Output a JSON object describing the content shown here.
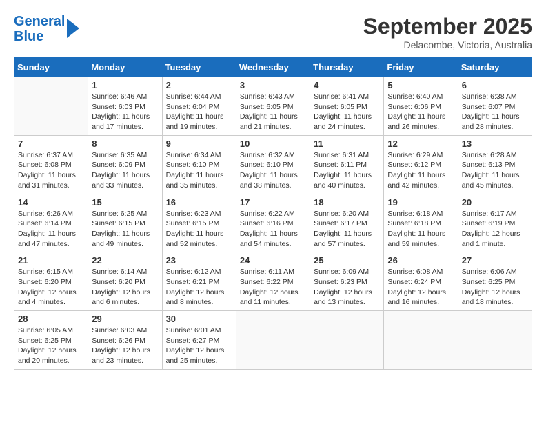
{
  "header": {
    "logo_line1": "General",
    "logo_line2": "Blue",
    "title": "September 2025",
    "subtitle": "Delacombe, Victoria, Australia"
  },
  "calendar": {
    "days_of_week": [
      "Sunday",
      "Monday",
      "Tuesday",
      "Wednesday",
      "Thursday",
      "Friday",
      "Saturday"
    ],
    "weeks": [
      [
        {
          "day": "",
          "info": ""
        },
        {
          "day": "1",
          "info": "Sunrise: 6:46 AM\nSunset: 6:03 PM\nDaylight: 11 hours and 17 minutes."
        },
        {
          "day": "2",
          "info": "Sunrise: 6:44 AM\nSunset: 6:04 PM\nDaylight: 11 hours and 19 minutes."
        },
        {
          "day": "3",
          "info": "Sunrise: 6:43 AM\nSunset: 6:05 PM\nDaylight: 11 hours and 21 minutes."
        },
        {
          "day": "4",
          "info": "Sunrise: 6:41 AM\nSunset: 6:05 PM\nDaylight: 11 hours and 24 minutes."
        },
        {
          "day": "5",
          "info": "Sunrise: 6:40 AM\nSunset: 6:06 PM\nDaylight: 11 hours and 26 minutes."
        },
        {
          "day": "6",
          "info": "Sunrise: 6:38 AM\nSunset: 6:07 PM\nDaylight: 11 hours and 28 minutes."
        }
      ],
      [
        {
          "day": "7",
          "info": "Sunrise: 6:37 AM\nSunset: 6:08 PM\nDaylight: 11 hours and 31 minutes."
        },
        {
          "day": "8",
          "info": "Sunrise: 6:35 AM\nSunset: 6:09 PM\nDaylight: 11 hours and 33 minutes."
        },
        {
          "day": "9",
          "info": "Sunrise: 6:34 AM\nSunset: 6:10 PM\nDaylight: 11 hours and 35 minutes."
        },
        {
          "day": "10",
          "info": "Sunrise: 6:32 AM\nSunset: 6:10 PM\nDaylight: 11 hours and 38 minutes."
        },
        {
          "day": "11",
          "info": "Sunrise: 6:31 AM\nSunset: 6:11 PM\nDaylight: 11 hours and 40 minutes."
        },
        {
          "day": "12",
          "info": "Sunrise: 6:29 AM\nSunset: 6:12 PM\nDaylight: 11 hours and 42 minutes."
        },
        {
          "day": "13",
          "info": "Sunrise: 6:28 AM\nSunset: 6:13 PM\nDaylight: 11 hours and 45 minutes."
        }
      ],
      [
        {
          "day": "14",
          "info": "Sunrise: 6:26 AM\nSunset: 6:14 PM\nDaylight: 11 hours and 47 minutes."
        },
        {
          "day": "15",
          "info": "Sunrise: 6:25 AM\nSunset: 6:15 PM\nDaylight: 11 hours and 49 minutes."
        },
        {
          "day": "16",
          "info": "Sunrise: 6:23 AM\nSunset: 6:15 PM\nDaylight: 11 hours and 52 minutes."
        },
        {
          "day": "17",
          "info": "Sunrise: 6:22 AM\nSunset: 6:16 PM\nDaylight: 11 hours and 54 minutes."
        },
        {
          "day": "18",
          "info": "Sunrise: 6:20 AM\nSunset: 6:17 PM\nDaylight: 11 hours and 57 minutes."
        },
        {
          "day": "19",
          "info": "Sunrise: 6:18 AM\nSunset: 6:18 PM\nDaylight: 11 hours and 59 minutes."
        },
        {
          "day": "20",
          "info": "Sunrise: 6:17 AM\nSunset: 6:19 PM\nDaylight: 12 hours and 1 minute."
        }
      ],
      [
        {
          "day": "21",
          "info": "Sunrise: 6:15 AM\nSunset: 6:20 PM\nDaylight: 12 hours and 4 minutes."
        },
        {
          "day": "22",
          "info": "Sunrise: 6:14 AM\nSunset: 6:20 PM\nDaylight: 12 hours and 6 minutes."
        },
        {
          "day": "23",
          "info": "Sunrise: 6:12 AM\nSunset: 6:21 PM\nDaylight: 12 hours and 8 minutes."
        },
        {
          "day": "24",
          "info": "Sunrise: 6:11 AM\nSunset: 6:22 PM\nDaylight: 12 hours and 11 minutes."
        },
        {
          "day": "25",
          "info": "Sunrise: 6:09 AM\nSunset: 6:23 PM\nDaylight: 12 hours and 13 minutes."
        },
        {
          "day": "26",
          "info": "Sunrise: 6:08 AM\nSunset: 6:24 PM\nDaylight: 12 hours and 16 minutes."
        },
        {
          "day": "27",
          "info": "Sunrise: 6:06 AM\nSunset: 6:25 PM\nDaylight: 12 hours and 18 minutes."
        }
      ],
      [
        {
          "day": "28",
          "info": "Sunrise: 6:05 AM\nSunset: 6:25 PM\nDaylight: 12 hours and 20 minutes."
        },
        {
          "day": "29",
          "info": "Sunrise: 6:03 AM\nSunset: 6:26 PM\nDaylight: 12 hours and 23 minutes."
        },
        {
          "day": "30",
          "info": "Sunrise: 6:01 AM\nSunset: 6:27 PM\nDaylight: 12 hours and 25 minutes."
        },
        {
          "day": "",
          "info": ""
        },
        {
          "day": "",
          "info": ""
        },
        {
          "day": "",
          "info": ""
        },
        {
          "day": "",
          "info": ""
        }
      ]
    ]
  }
}
